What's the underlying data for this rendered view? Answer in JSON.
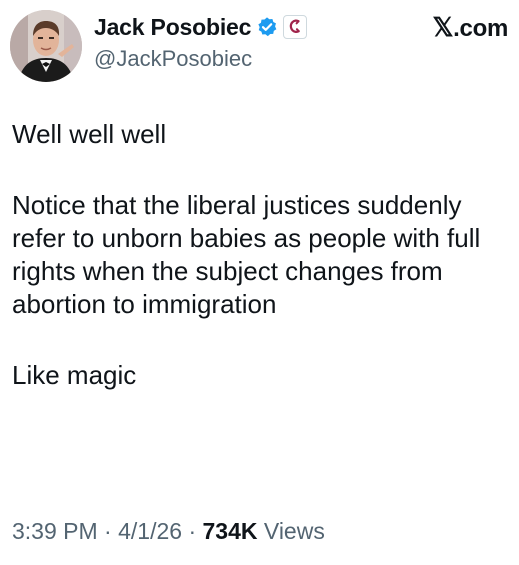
{
  "author": {
    "display_name": "Jack Posobiec",
    "handle": "@JackPosobiec",
    "avatar_icon": "profile-photo",
    "verified_icon": "verified-badge-icon",
    "affiliate_icon": "affiliate-badge-icon"
  },
  "brand": {
    "label": "X.com",
    "x_glyph": "𝕏",
    "rest": ".com"
  },
  "tweet": {
    "line1": "Well well well",
    "paragraph2": "Notice that the liberal justices suddenly refer to unborn babies as people with full rights when the subject changes from abortion to immigration",
    "line3": "Like magic"
  },
  "meta": {
    "time": "3:39 PM",
    "sep1": " · ",
    "date": "4/1/26",
    "sep2": " · ",
    "views_count": "734K",
    "views_label": " Views"
  },
  "colors": {
    "text": "#0f1419",
    "secondary": "#536471",
    "verified_blue": "#1d9bf0",
    "affiliate_accent": "#a0244b"
  }
}
